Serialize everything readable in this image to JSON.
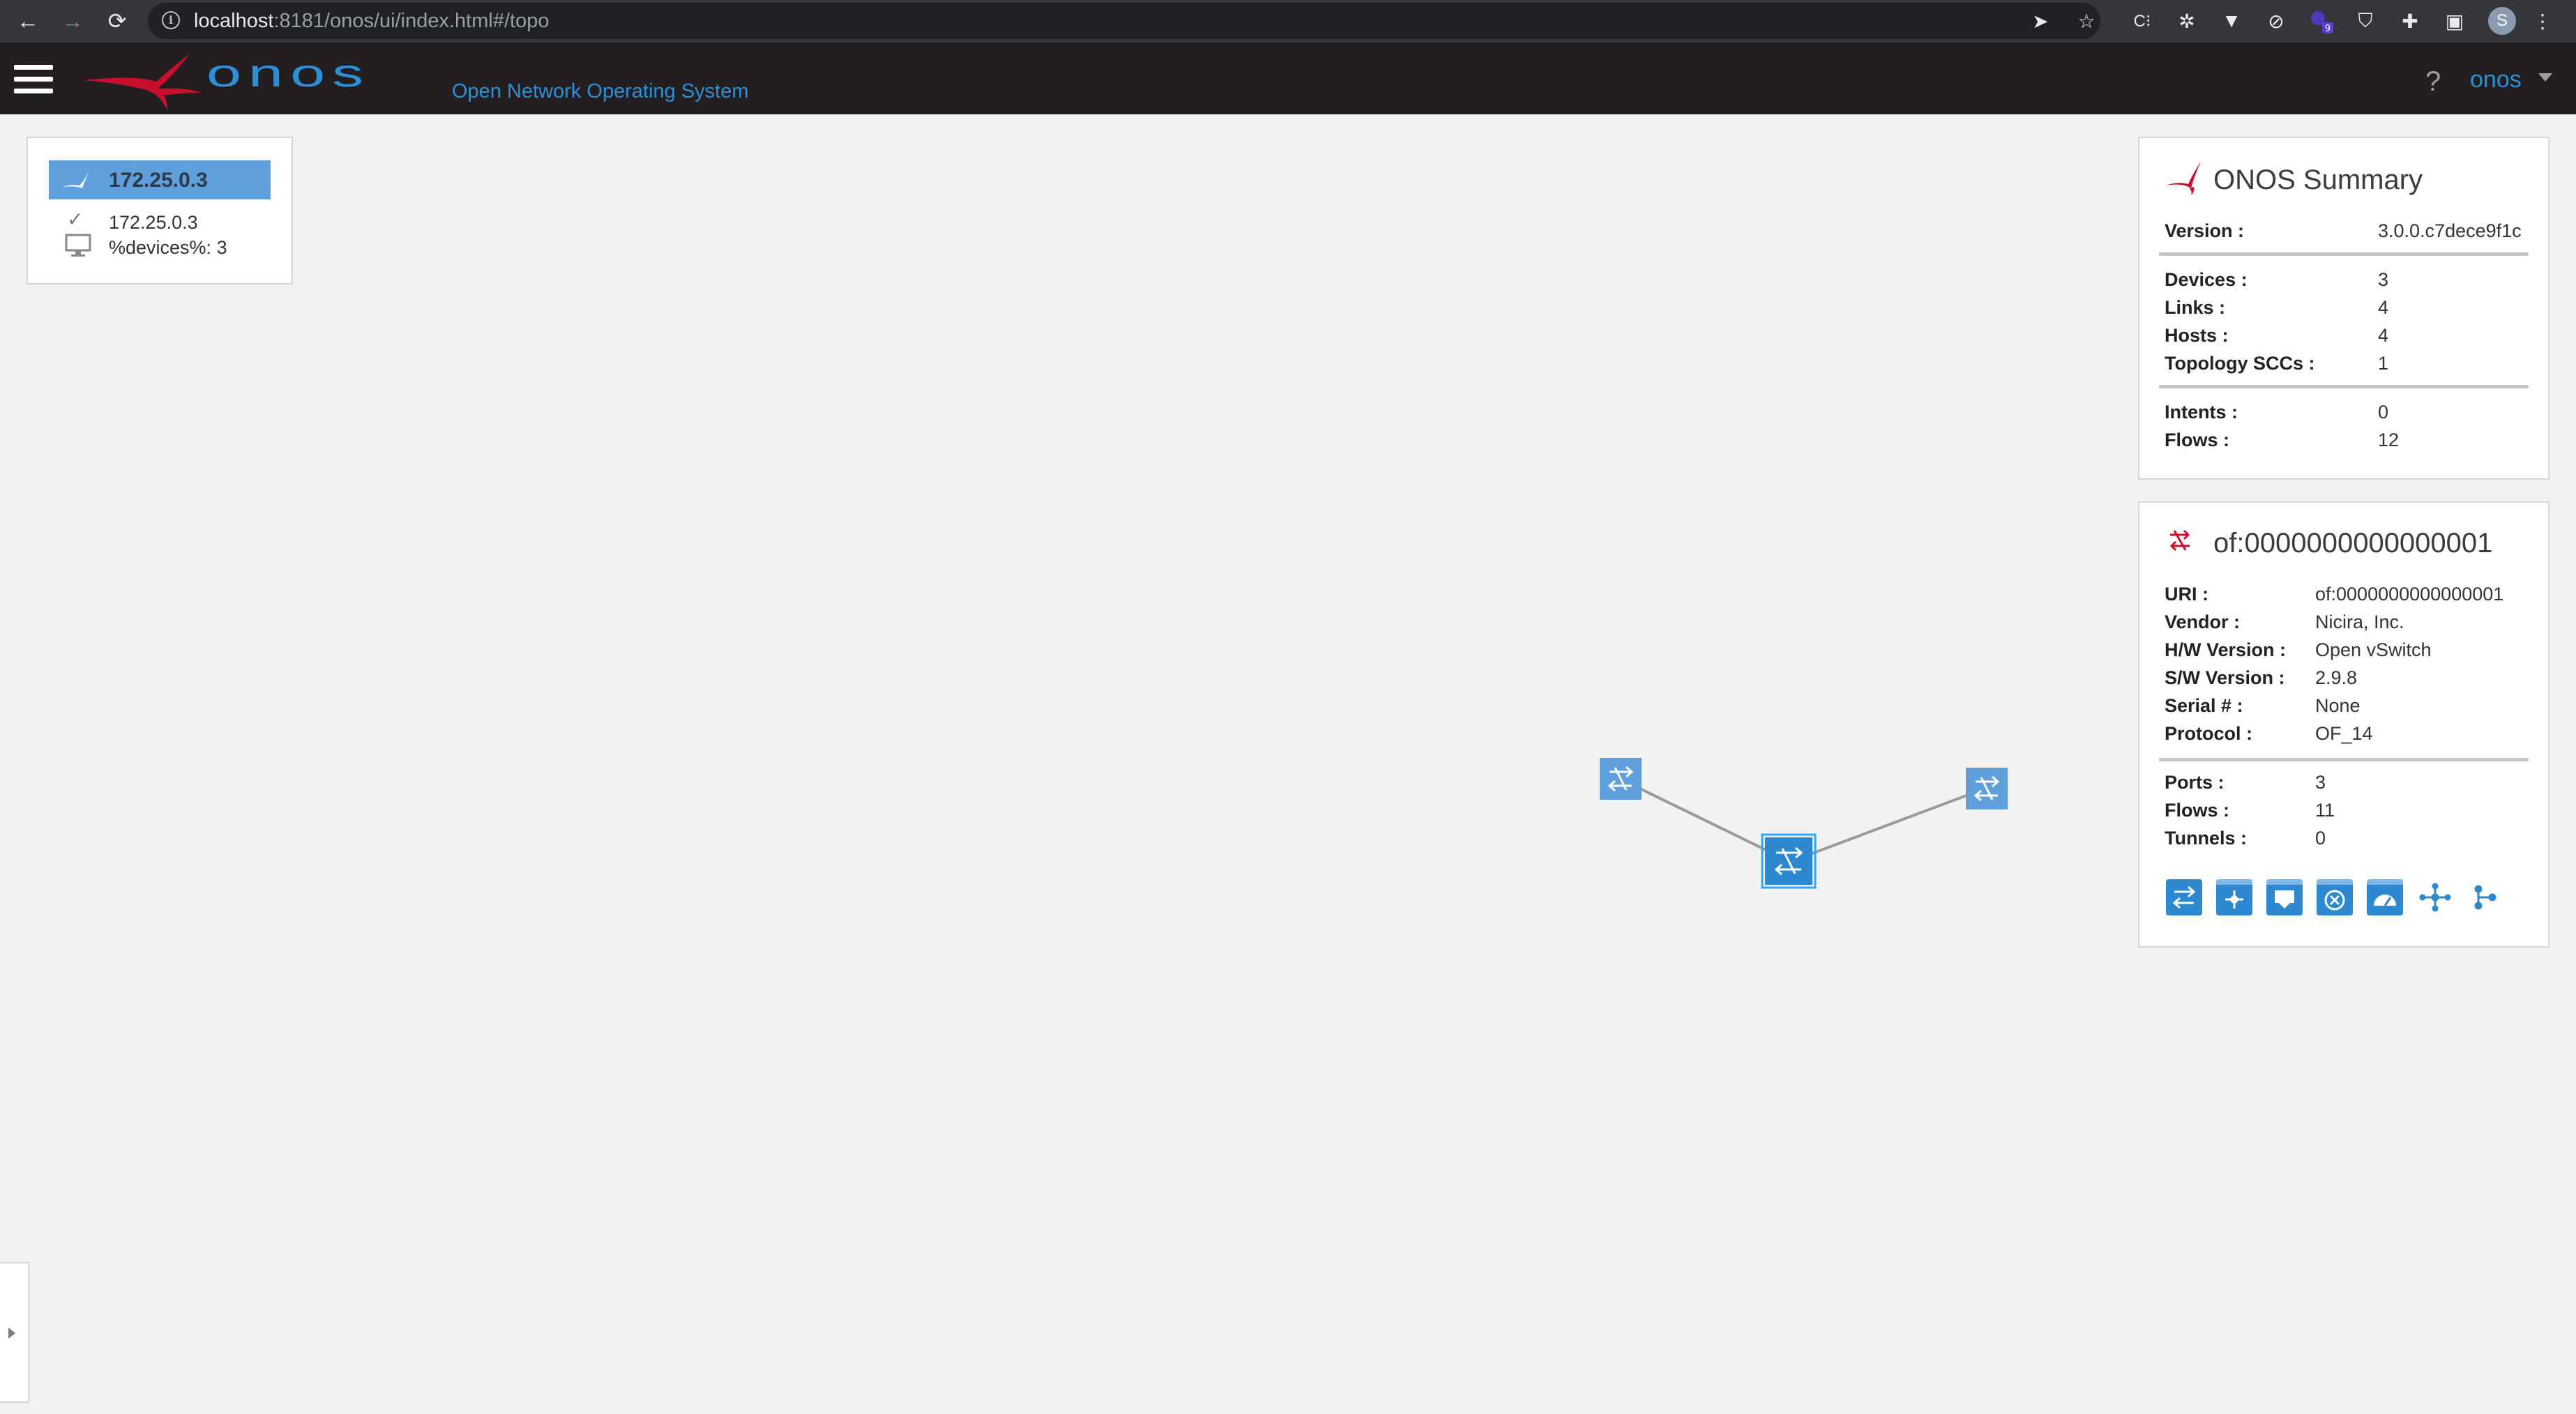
{
  "browser": {
    "url_host": "localhost",
    "url_path": ":8181/onos/ui/index.html#/topo",
    "profile_initial": "S",
    "extension_badge": "9",
    "icons": [
      "back-icon",
      "forward-icon",
      "reload-icon",
      "site-info-icon",
      "send-icon",
      "star-icon",
      "extension-icon",
      "puzzle-icon",
      "sidebar-icon",
      "kebab-menu-icon"
    ]
  },
  "masthead": {
    "logo_text": "onos",
    "tagline": "Open Network Operating System",
    "help": "?",
    "user": "onos"
  },
  "instance_panel": {
    "title": "172.25.0.3",
    "ip": "172.25.0.3",
    "devices": "%devices%: 3"
  },
  "summary": {
    "title": "ONOS Summary",
    "version_label": "Version :",
    "version": "3.0.0.c7dece9f1c",
    "devices_label": "Devices :",
    "devices": "3",
    "links_label": "Links :",
    "links": "4",
    "hosts_label": "Hosts :",
    "hosts": "4",
    "sccs_label": "Topology SCCs :",
    "sccs": "1",
    "intents_label": "Intents :",
    "intents": "0",
    "flows_label": "Flows :",
    "flows": "12"
  },
  "device": {
    "title": "of:0000000000000001",
    "uri_label": "URI :",
    "uri": "of:0000000000000001",
    "vendor_label": "Vendor :",
    "vendor": "Nicira, Inc.",
    "hw_label": "H/W Version :",
    "hw": "Open vSwitch",
    "sw_label": "S/W Version :",
    "sw": "2.9.8",
    "serial_label": "Serial # :",
    "serial": "None",
    "protocol_label": "Protocol :",
    "protocol": "OF_14",
    "ports_label": "Ports :",
    "ports": "3",
    "flows_label": "Flows :",
    "flows": "11",
    "tunnels_label": "Tunnels :",
    "tunnels": "0",
    "actions": [
      "flows-table-icon",
      "ports-table-icon",
      "groups-table-icon",
      "meters-table-icon",
      "pipeconf-icon",
      "meter-reading-icon",
      "topology-add-icon"
    ]
  },
  "topology": {
    "nodes": [
      "switch-1",
      "switch-2",
      "switch-3"
    ],
    "selected": "switch-2"
  },
  "colors": {
    "accent": "#2d8fd5",
    "node": "#5f9fdb",
    "node_selected": "#2e88d0",
    "brand_red": "#c8102e",
    "masthead": "#231f20"
  }
}
